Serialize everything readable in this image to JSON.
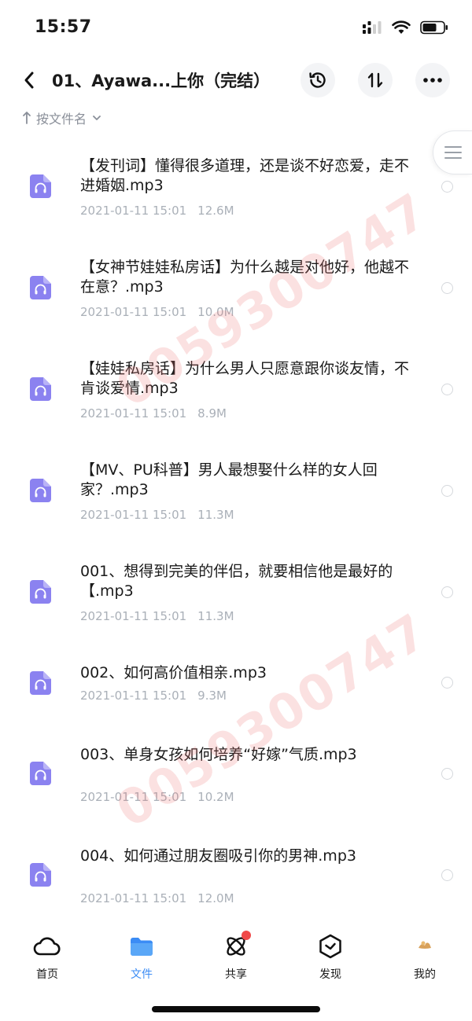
{
  "status": {
    "time": "15:57"
  },
  "header": {
    "title": "01、Ayawa...上你（完结）"
  },
  "sort": {
    "label": "按文件名"
  },
  "files": [
    {
      "name": "【发刊词】懂得很多道理，还是谈不好恋爱，走不进婚姻.mp3",
      "date": "2021-01-11 15:01",
      "size": "12.6M"
    },
    {
      "name": "【女神节娃娃私房话】为什么越是对他好，他越不在意？.mp3",
      "date": "2021-01-11 15:01",
      "size": "10.0M"
    },
    {
      "name": "【娃娃私房话】为什么男人只愿意跟你谈友情，不肯谈爱情.mp3",
      "date": "2021-01-11 15:01",
      "size": "8.9M"
    },
    {
      "name": "【MV、PU科普】男人最想娶什么样的女人回家？.mp3",
      "date": "2021-01-11 15:01",
      "size": "11.3M"
    },
    {
      "name": "001、想得到完美的伴侣，就要相信他是最好的【.mp3",
      "date": "2021-01-11 15:01",
      "size": "11.3M"
    },
    {
      "name": "002、如何高价值相亲.mp3",
      "date": "2021-01-11 15:01",
      "size": "9.3M"
    },
    {
      "name": "003、单身女孩如何培养“好嫁”气质.mp3",
      "date": "2021-01-11 15:01",
      "size": "10.2M"
    },
    {
      "name": "004、如何通过朋友圈吸引你的男神.mp3",
      "date": "2021-01-11 15:01",
      "size": "12.0M"
    }
  ],
  "watermark": {
    "text": "0059300747"
  },
  "tabs": [
    {
      "label": "首页",
      "icon": "cloud-icon",
      "active": false
    },
    {
      "label": "文件",
      "icon": "folder-icon",
      "active": true
    },
    {
      "label": "共享",
      "icon": "atom-icon",
      "active": false,
      "badge": true
    },
    {
      "label": "发现",
      "icon": "compass-icon",
      "active": false
    },
    {
      "label": "我的",
      "icon": "avatar-icon",
      "active": false
    }
  ],
  "colors": {
    "accent": "#3b8cf5",
    "file_icon": "#8b82f0",
    "badge": "#f04848",
    "watermark": "#eb7878"
  }
}
